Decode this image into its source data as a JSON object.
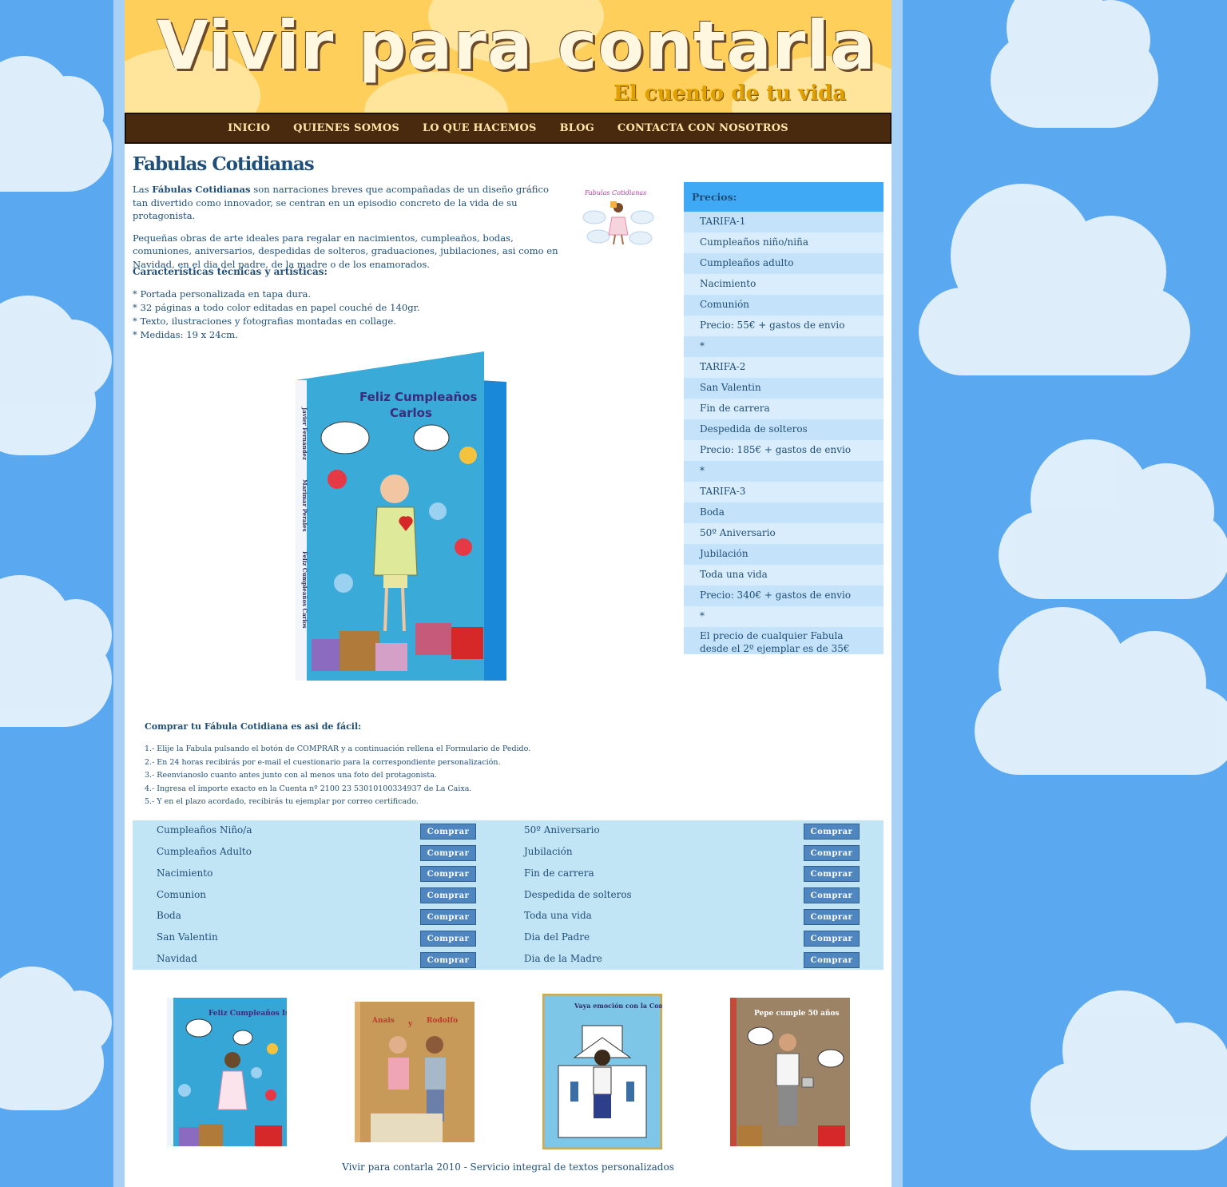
{
  "header": {
    "title": "Vivir para contarla",
    "subtitle": "El cuento de tu vida"
  },
  "nav": {
    "items": [
      "INICIO",
      "QUIENES SOMOS",
      "LO QUE HACEMOS",
      "BLOG",
      "CONTACTA CON NOSOTROS"
    ]
  },
  "main": {
    "title": "Fabulas Cotidianas",
    "intro_p1_prefix": "Las ",
    "intro_p1_bold": "Fábulas Cotidianas",
    "intro_p1_rest": " son narraciones breves que acompañadas de un diseño gráfico tan divertido como innovador, se centran en un episodio concreto de la vida de su protagonista.",
    "intro_p2": "Pequeñas obras de arte ideales para regalar en nacimientos, cumpleaños, bodas, comuniones, aniversarios, despedidas de solteros, graduaciones, jubilaciones, asi como en Navidad, en el dia del padre, de la madre o de los enamorados.",
    "features_heading": "Características técnicas y artísticas:",
    "features": [
      "* Portada personalizada en tapa dura.",
      "* 32 páginas a todo color editadas en papel couché de 140gr.",
      "* Texto, ilustraciones y fotografias montadas en collage.",
      "* Medidas: 19 x 24cm."
    ],
    "thumb_title": "Fabulas Cotidianas",
    "book_cover": {
      "title_line1": "Feliz Cumpleaños",
      "title_line2": "Carlos",
      "spine_author": "Javier Fernández",
      "spine_author2": "Marimar Perales",
      "spine_title": "Feliz Cumpleaños Carlos"
    }
  },
  "prices": {
    "header": "Precios:",
    "rows": [
      "TARIFA-1",
      "Cumpleaños niño/niña",
      "Cumpleaños adulto",
      "Nacimiento",
      "Comunión",
      "Precio: 55€ + gastos de envio",
      "*",
      "TARIFA-2",
      "San Valentin",
      "Fin de carrera",
      "Despedida de solteros",
      "Precio: 185€ + gastos de envio",
      "*",
      "TARIFA-3",
      "Boda",
      "50º Aniversario",
      "Jubilación",
      "Toda una vida",
      "Precio: 340€ + gastos de envio",
      "*",
      "El precio de cualquier Fabula desde el 2º ejemplar es de 35€"
    ]
  },
  "buy": {
    "heading": "Comprar tu Fábula Cotidiana es asi de fácil:",
    "steps": [
      "1.- Elije la Fabula pulsando el botón de COMPRAR y a continuación rellena el Formulario de Pedido.",
      "2.- En 24 horas recibirás por e-mail el cuestionario para la correspondiente personalización.",
      "3.- Reenvianoslo cuanto antes junto con al menos una foto del protagonista.",
      "4.- Ingresa el importe exacto en la Cuenta nº 2100 23 53010100334937 de La Caixa.",
      "5.- Y en el plazo acordado, recibirás tu ejemplar por correo certificado."
    ],
    "button_label": "Comprar",
    "left_items": [
      "Cumpleaños Niño/a",
      "Cumpleaños Adulto",
      "Nacimiento",
      "Comunion",
      "Boda",
      "San Valentin",
      "Navidad"
    ],
    "right_items": [
      "50º Aniversario",
      "Jubilación",
      "Fin de carrera",
      "Despedida de solteros",
      "Toda una vida",
      "Dia del Padre",
      "Dia de la Madre"
    ]
  },
  "gallery": [
    {
      "title": "Feliz Cumpleaños Isabel"
    },
    {
      "title_left": "Anais",
      "title_mid": "y",
      "title_right": "Rodolfo"
    },
    {
      "title": "Vaya emoción con la Comunión..."
    },
    {
      "title": "Pepe cumple 50 años"
    }
  ],
  "footer": {
    "text": "Vivir para contarla 2010 - Servicio integral de textos personalizados"
  },
  "colors": {
    "sky": "#5aa8ef",
    "banner": "#ffcf5c",
    "nav_bg": "#4a2a0e",
    "text": "#1f4e79",
    "price_header": "#3fa9f5",
    "button": "#4f86c0"
  }
}
